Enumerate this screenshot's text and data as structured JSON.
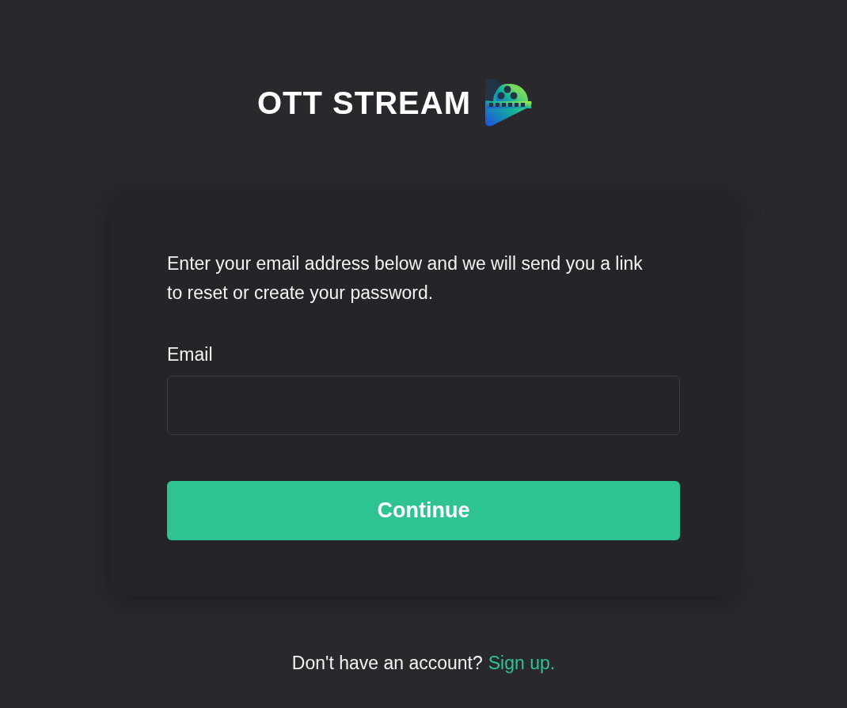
{
  "logo": {
    "text": "OTT STREAM"
  },
  "card": {
    "instructions": "Enter your email address below and we will send you a link to reset or create your password.",
    "email_field": {
      "label": "Email"
    },
    "button": "Continue"
  },
  "footer": {
    "text": "Don't have an account?",
    "link": "Sign up."
  }
}
